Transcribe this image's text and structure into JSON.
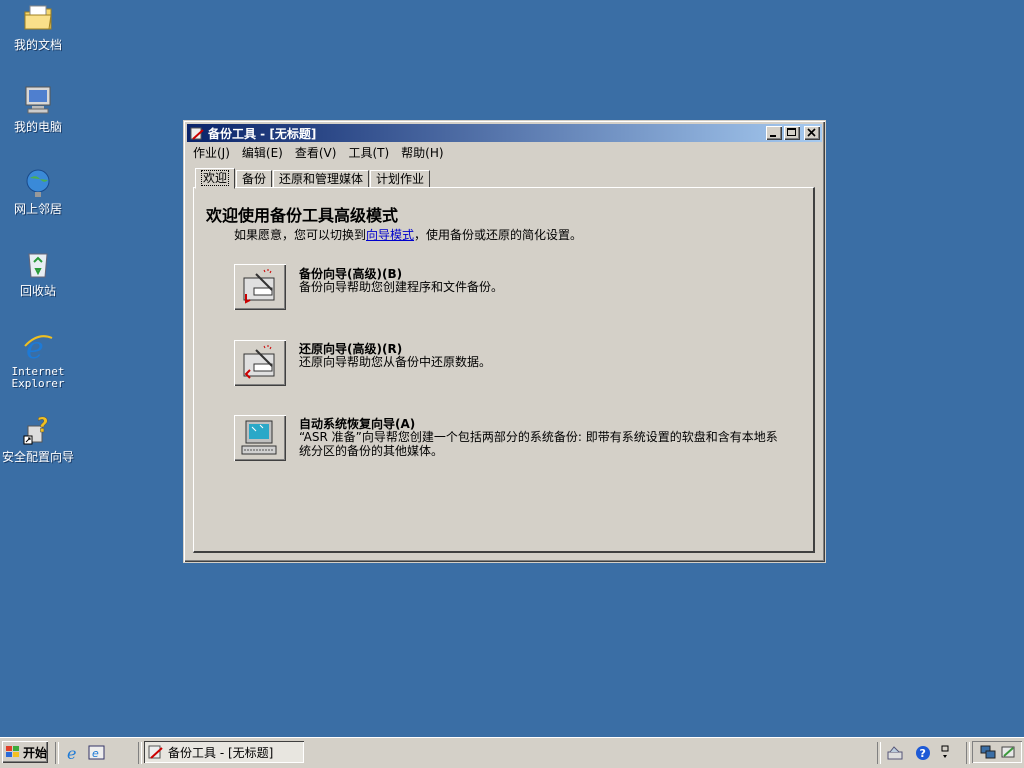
{
  "desktop": {
    "icons": [
      {
        "label": "我的文档",
        "icon": "folder-icon"
      },
      {
        "label": "我的电脑",
        "icon": "computer-icon"
      },
      {
        "label": "网上邻居",
        "icon": "network-icon"
      },
      {
        "label": "回收站",
        "icon": "recycle-bin-icon"
      },
      {
        "label": "Internet Explorer",
        "icon": "ie-icon"
      },
      {
        "label": "安全配置向导",
        "icon": "security-wizard-icon"
      }
    ]
  },
  "window": {
    "title": "备份工具 - [无标题]",
    "menu": [
      "作业(J)",
      "编辑(E)",
      "查看(V)",
      "工具(T)",
      "帮助(H)"
    ],
    "tabs": [
      "欢迎",
      "备份",
      "还原和管理媒体",
      "计划作业"
    ],
    "active_tab": "欢迎",
    "heading": "欢迎使用备份工具高级模式",
    "intro_before": "如果愿意，您可以切换到",
    "intro_link": "向导模式",
    "intro_after": "，使用备份或还原的简化设置。",
    "wizards": [
      {
        "title": "备份向导(高级)(B)",
        "desc": "备份向导帮助您创建程序和文件备份。"
      },
      {
        "title": "还原向导(高级)(R)",
        "desc": "还原向导帮助您从备份中还原数据。"
      },
      {
        "title": "自动系统恢复向导(A)",
        "desc": "“ASR 准备”向导帮您创建一个包括两部分的系统备份: 即带有系统设置的软盘和含有本地系统分区的备份的其他媒体。"
      }
    ]
  },
  "taskbar": {
    "start_label": "开始",
    "task_label": "备份工具 - [无标题]"
  }
}
